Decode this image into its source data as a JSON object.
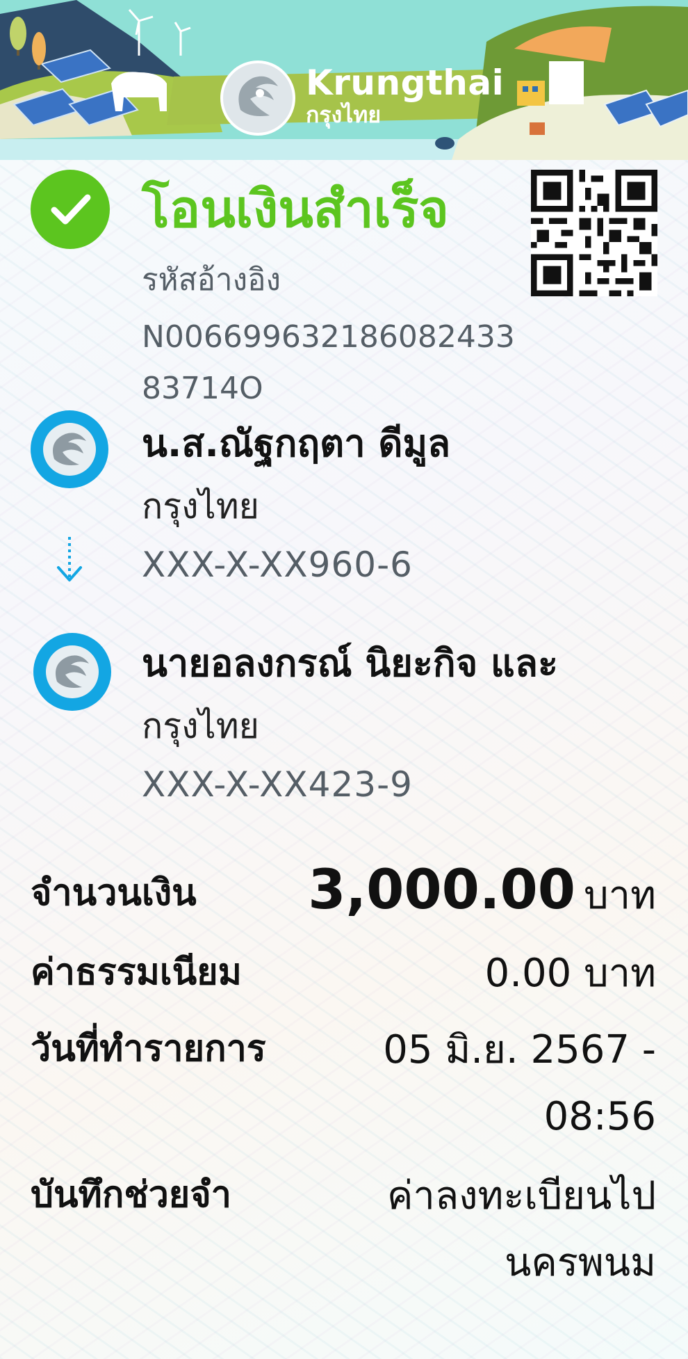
{
  "header": {
    "brand_en": "Krungthai",
    "brand_th": "กรุงไทย",
    "logo_icon": "krungthai-bird-logo-icon"
  },
  "status": {
    "title": "โอนเงินสำเร็จ",
    "icon": "check-icon",
    "color": "#5cc51f"
  },
  "reference": {
    "label": "รหัสอ้างอิง",
    "value": "N00669963218608243383714O"
  },
  "qr_icon": "qr-code-icon",
  "sender": {
    "name": "น.ส.ณัฐกฤตา ดีมูล",
    "bank": "กรุงไทย",
    "account": "XXX-X-XX960-6"
  },
  "receiver": {
    "name": "นายอลงกรณ์ นิยะกิจ และ",
    "bank": "กรุงไทย",
    "account": "XXX-X-XX423-9"
  },
  "details": {
    "amount_label": "จำนวนเงิน",
    "amount_value": "3,000.00",
    "amount_unit": "บาท",
    "fee_label": "ค่าธรรมเนียม",
    "fee_value": "0.00 บาท",
    "date_label": "วันที่ทำรายการ",
    "date_value_line1": "05 มิ.ย. 2567 -",
    "date_value_line2": "08:56",
    "memo_label": "บันทึกช่วยจำ",
    "memo_value_line1": "ค่าลงทะเบียนไป",
    "memo_value_line2": "นครพนม"
  },
  "colors": {
    "accent_green": "#5cc51f",
    "bank_blue": "#13a6e3",
    "muted_text": "#555e66"
  }
}
